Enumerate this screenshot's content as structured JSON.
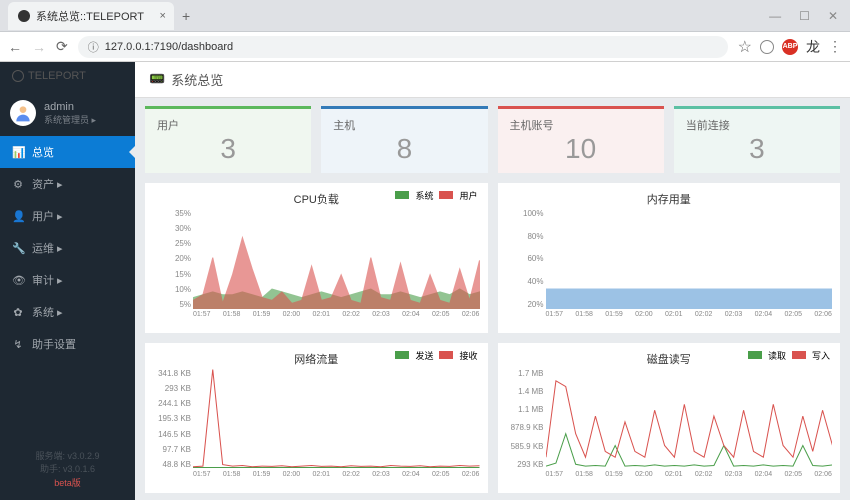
{
  "browser": {
    "tab_title": "系统总览::TELEPORT",
    "url": "127.0.0.1:7190/dashboard",
    "new_tab": "+"
  },
  "sidebar": {
    "logo": "TELEPORT",
    "user": {
      "name": "admin",
      "role": "系统管理员 ▸"
    },
    "nav": [
      {
        "icon": "📊",
        "label": "总览",
        "active": true
      },
      {
        "icon": "⚙",
        "label": "资产 ▸"
      },
      {
        "icon": "👤",
        "label": "用户 ▸"
      },
      {
        "icon": "🔧",
        "label": "运维 ▸"
      },
      {
        "icon": "👁",
        "label": "审计 ▸"
      },
      {
        "icon": "✿",
        "label": "系统 ▸"
      },
      {
        "icon": "↯",
        "label": "助手设置"
      }
    ],
    "footer": {
      "server": "服务端: v3.0.2.9",
      "client": "助手: v3.0.1.6",
      "beta": "beta版"
    }
  },
  "header": {
    "title": "系统总览"
  },
  "stats": [
    {
      "label": "用户",
      "value": "3",
      "cls": "green"
    },
    {
      "label": "主机",
      "value": "8",
      "cls": "blue"
    },
    {
      "label": "主机账号",
      "value": "10",
      "cls": "red"
    },
    {
      "label": "当前连接",
      "value": "3",
      "cls": "teal"
    }
  ],
  "chart_data": [
    {
      "type": "area",
      "title": "CPU负载",
      "legend": [
        {
          "name": "系统",
          "color": "#4a9e4a"
        },
        {
          "name": "用户",
          "color": "#d9534f"
        }
      ],
      "ylabels": [
        "35%",
        "30%",
        "25%",
        "20%",
        "15%",
        "10%",
        "5%"
      ],
      "xlabels": [
        "01:57",
        "01:58",
        "01:59",
        "02:00",
        "02:01",
        "02:02",
        "02:03",
        "02:04",
        "02:05",
        "02:06"
      ],
      "series": [
        {
          "name": "系统",
          "values": [
            4,
            5,
            6,
            5,
            5,
            6,
            5,
            4,
            7,
            6,
            5,
            4,
            5,
            6,
            5,
            4,
            5,
            6,
            7,
            5,
            5,
            6,
            5,
            4,
            5,
            6,
            5,
            7,
            5,
            6
          ]
        },
        {
          "name": "用户",
          "values": [
            3,
            5,
            18,
            2,
            12,
            25,
            14,
            4,
            3,
            6,
            2,
            3,
            15,
            3,
            4,
            12,
            3,
            2,
            18,
            4,
            3,
            16,
            3,
            2,
            12,
            3,
            2,
            14,
            3,
            17
          ]
        }
      ],
      "ylim": [
        0,
        35
      ]
    },
    {
      "type": "area",
      "title": "内存用量",
      "legend": [],
      "ylabels": [
        "100%",
        "80%",
        "60%",
        "40%",
        "20%"
      ],
      "xlabels": [
        "01:57",
        "01:58",
        "01:59",
        "02:00",
        "02:01",
        "02:02",
        "02:03",
        "02:04",
        "02:05",
        "02:06"
      ],
      "series": [
        {
          "name": "mem",
          "values": [
            20,
            20,
            20,
            20,
            20,
            20,
            20,
            20,
            20,
            20,
            20,
            20,
            20,
            20,
            20,
            20,
            20,
            20,
            20,
            20,
            20,
            20,
            20,
            20,
            20,
            20,
            20,
            20,
            20,
            20
          ]
        }
      ],
      "ylim": [
        0,
        100
      ]
    },
    {
      "type": "line",
      "title": "网络流量",
      "legend": [
        {
          "name": "发送",
          "color": "#4a9e4a"
        },
        {
          "name": "接收",
          "color": "#d9534f"
        }
      ],
      "ylabels": [
        "341.8 KB",
        "293 KB",
        "244.1 KB",
        "195.3 KB",
        "146.5 KB",
        "97.7 KB",
        "48.8 KB"
      ],
      "xlabels": [
        "01:57",
        "01:58",
        "01:59",
        "02:00",
        "02:01",
        "02:02",
        "02:03",
        "02:04",
        "02:05",
        "02:06"
      ],
      "series": [
        {
          "name": "发送",
          "values": [
            5,
            5,
            5,
            5,
            5,
            5,
            5,
            5,
            5,
            5,
            5,
            5,
            5,
            5,
            5,
            5,
            5,
            5,
            5,
            5,
            5,
            5,
            5,
            5,
            5,
            5,
            5,
            5,
            5,
            5
          ]
        },
        {
          "name": "接收",
          "values": [
            8,
            10,
            340,
            15,
            10,
            12,
            8,
            10,
            9,
            11,
            8,
            10,
            12,
            9,
            10,
            8,
            11,
            9,
            10,
            8,
            12,
            10,
            9,
            11,
            8,
            10,
            9,
            12,
            10,
            11
          ]
        }
      ],
      "ylim": [
        0,
        342
      ]
    },
    {
      "type": "line",
      "title": "磁盘读写",
      "legend": [
        {
          "name": "读取",
          "color": "#4a9e4a"
        },
        {
          "name": "写入",
          "color": "#d9534f"
        }
      ],
      "ylabels": [
        "1.7 MB",
        "1.4 MB",
        "1.1 MB",
        "878.9 KB",
        "585.9 KB",
        "293 KB"
      ],
      "xlabels": [
        "01:57",
        "01:58",
        "01:59",
        "02:00",
        "02:01",
        "02:02",
        "02:03",
        "02:04",
        "02:05",
        "02:06"
      ],
      "series": [
        {
          "name": "读取",
          "values": [
            50,
            100,
            600,
            80,
            50,
            60,
            50,
            400,
            50,
            60,
            50,
            70,
            50,
            60,
            50,
            70,
            50,
            60,
            400,
            50,
            60,
            50,
            70,
            50,
            60,
            50,
            400,
            60,
            50,
            70
          ]
        },
        {
          "name": "写入",
          "values": [
            200,
            1500,
            1400,
            600,
            200,
            900,
            300,
            200,
            800,
            300,
            200,
            1000,
            400,
            200,
            1100,
            300,
            200,
            900,
            400,
            200,
            1000,
            300,
            200,
            1100,
            400,
            200,
            900,
            300,
            1000,
            400
          ]
        }
      ],
      "ylim": [
        0,
        1700
      ]
    }
  ]
}
